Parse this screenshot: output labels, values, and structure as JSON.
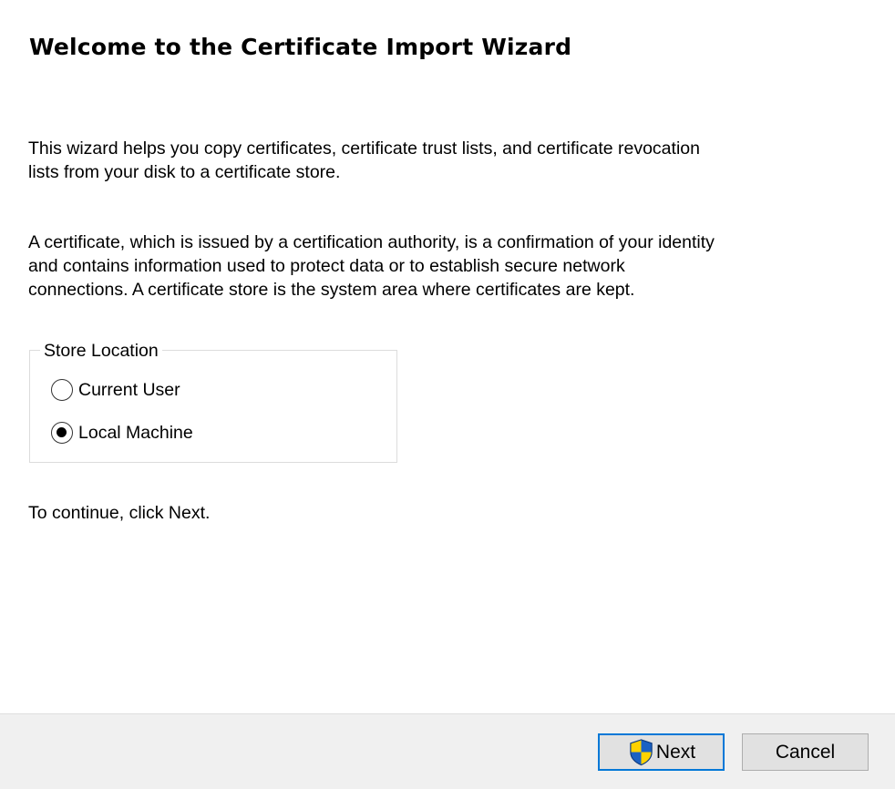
{
  "wizard": {
    "title": "Welcome to the Certificate Import Wizard",
    "intro_lines": [
      "This wizard helps you copy certificates, certificate trust lists, and certificate revocation",
      "lists from your disk to a certificate store."
    ],
    "description_lines": [
      "A certificate, which is issued by a certification authority, is a confirmation of your identity",
      "and contains information used to protect data or to establish secure network",
      "connections. A certificate store is the system area where certificates are kept."
    ],
    "store_location": {
      "label": "Store Location",
      "options": [
        {
          "label": "Current User",
          "selected": false
        },
        {
          "label": "Local Machine",
          "selected": true
        }
      ]
    },
    "continue_text": "To continue, click Next."
  },
  "footer": {
    "next_label": "Next",
    "next_icon": "uac-shield-icon",
    "cancel_label": "Cancel",
    "accent_color": "#0078d7",
    "shield_colors": [
      "#ffd200",
      "#1b61c3"
    ]
  }
}
